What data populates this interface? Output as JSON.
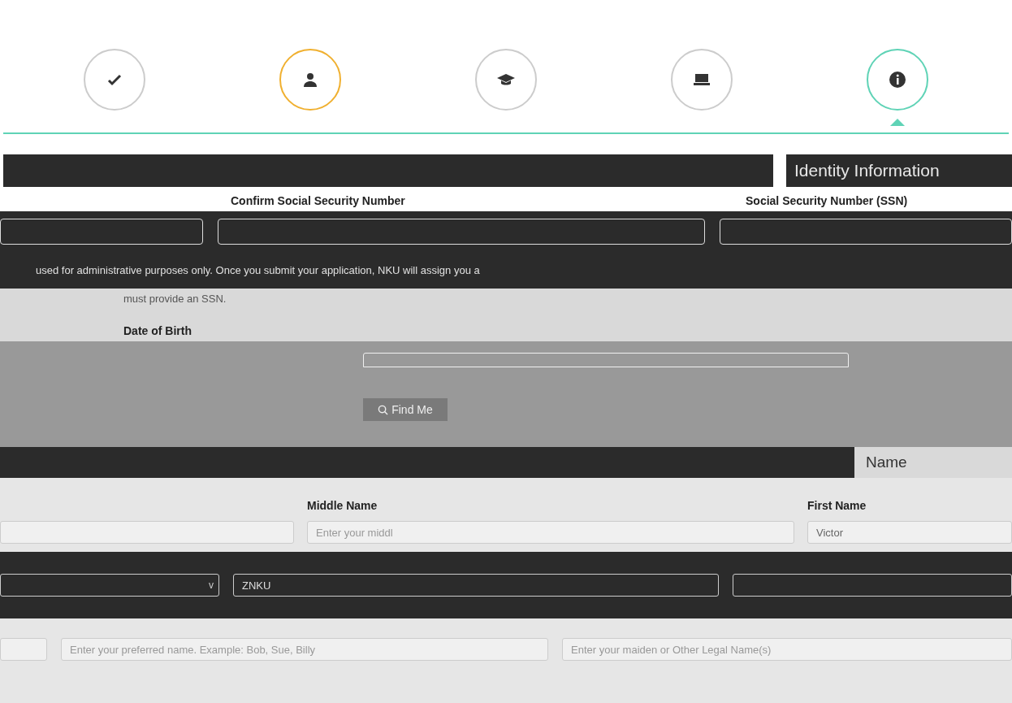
{
  "steps": [
    {
      "kind": "check",
      "current": false,
      "highlighted": false
    },
    {
      "kind": "person",
      "current": false,
      "highlighted": true
    },
    {
      "kind": "cap",
      "current": false,
      "highlighted": false
    },
    {
      "kind": "laptop",
      "current": false,
      "highlighted": false
    },
    {
      "kind": "info",
      "current": true,
      "highlighted": false
    }
  ],
  "identity_section": {
    "title": "Identity Information",
    "fields": [
      {
        "label": "Confirm Social Security Number"
      },
      {
        "label": "Social Security Number (SSN)"
      }
    ],
    "note_dark": "used for administrative purposes only. Once you submit your application, NKU will assign you a",
    "note_light": "must provide an SSN.",
    "dob_label": "Date of Birth",
    "find_button": "Find Me"
  },
  "name_section": {
    "title": "Name",
    "labels": [
      "Middle Name",
      "First Name"
    ],
    "middle_placeholder": "Enter your middl",
    "first_value": "Victor",
    "select_caret": "v",
    "suffix_value": "ZNKU",
    "preferred_placeholder": "Enter your preferred name. Example: Bob, Sue, Billy",
    "maiden_placeholder": "Enter your maiden or Other Legal Name(s)"
  }
}
